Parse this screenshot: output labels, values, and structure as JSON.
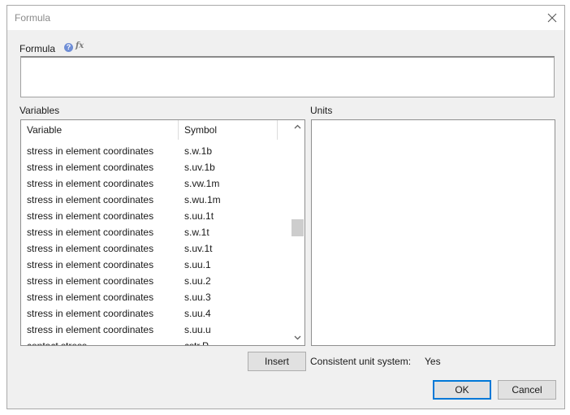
{
  "window": {
    "title": "Formula"
  },
  "formula": {
    "label": "Formula",
    "value": "",
    "help_icon_glyph": "?",
    "fx_icon_glyph": "fx"
  },
  "variables": {
    "label": "Variables",
    "columns": [
      "Variable",
      "Symbol"
    ],
    "rows": [
      {
        "variable": "stress in element coordinates",
        "symbol": "s.w.1b"
      },
      {
        "variable": "stress in element coordinates",
        "symbol": "s.uv.1b"
      },
      {
        "variable": "stress in element coordinates",
        "symbol": "s.vw.1m"
      },
      {
        "variable": "stress in element coordinates",
        "symbol": "s.wu.1m"
      },
      {
        "variable": "stress in element coordinates",
        "symbol": "s.uu.1t"
      },
      {
        "variable": "stress in element coordinates",
        "symbol": "s.w.1t"
      },
      {
        "variable": "stress in element coordinates",
        "symbol": "s.uv.1t"
      },
      {
        "variable": "stress in element coordinates",
        "symbol": "s.uu.1"
      },
      {
        "variable": "stress in element coordinates",
        "symbol": "s.uu.2"
      },
      {
        "variable": "stress in element coordinates",
        "symbol": "s.uu.3"
      },
      {
        "variable": "stress in element coordinates",
        "symbol": "s.uu.4"
      },
      {
        "variable": "stress in element coordinates",
        "symbol": "s.uu.u"
      },
      {
        "variable": "contact stress",
        "symbol": "cstr.P"
      }
    ]
  },
  "units": {
    "label": "Units"
  },
  "buttons": {
    "insert": "Insert",
    "ok": "OK",
    "cancel": "Cancel"
  },
  "unit_system": {
    "label": "Consistent unit system:",
    "value": "Yes"
  },
  "icons": {
    "close": "close-icon",
    "help": "help-icon",
    "fx": "fx-icon",
    "scroll_up": "chevron-up-icon",
    "scroll_down": "chevron-down-icon"
  },
  "colors": {
    "window_bg": "#f0f0f0",
    "accent": "#0078d7",
    "help_icon": "#6f8ed6"
  }
}
